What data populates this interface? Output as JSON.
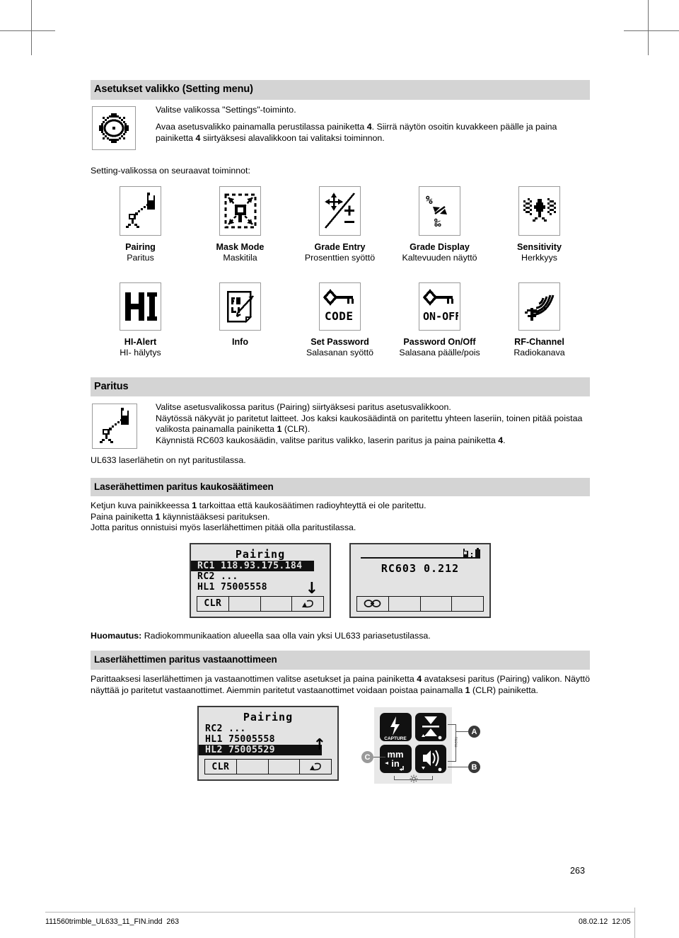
{
  "section_setting": {
    "header": "Asetukset valikko (Setting menu)",
    "icon": "gear-icon",
    "paragraphs": [
      "Valitse valikossa \"Settings\"-toiminto.",
      "Avaa asetusvalikko painamalla perustilassa painiketta 4. Siirrä näytön osoitin kuvakkeen päälle ja paina painiketta 4 siirtyäksesi alavalikkoon tai valitaksi toiminnon."
    ],
    "after_line": "Setting-valikossa on seuraavat toiminnot:"
  },
  "icon_grid": {
    "row1": [
      {
        "icon": "pairing-icon",
        "en": "Pairing",
        "fi": "Paritus"
      },
      {
        "icon": "mask-mode-icon",
        "en": "Mask Mode",
        "fi": "Maskitila"
      },
      {
        "icon": "grade-entry-icon",
        "en": "Grade Entry",
        "fi": "Prosenttien syöttö"
      },
      {
        "icon": "grade-display-icon",
        "en": "Grade Display",
        "fi": "Kaltevuuden näyttö"
      },
      {
        "icon": "sensitivity-icon",
        "en": "Sensitivity",
        "fi": "Herkkyys"
      }
    ],
    "row2": [
      {
        "icon": "hi-alert-icon",
        "en": "HI-Alert",
        "fi": "HI- hälytys"
      },
      {
        "icon": "info-icon",
        "en": "Info",
        "fi": ""
      },
      {
        "icon": "set-password-icon",
        "en": "Set Password",
        "fi": "Salasanan syöttö"
      },
      {
        "icon": "password-onoff-icon",
        "en": "Password On/Off",
        "fi": "Salasana päälle/pois"
      },
      {
        "icon": "rf-channel-icon",
        "en": "RF-Channel",
        "fi": "Radiokanava"
      }
    ]
  },
  "section_paritus": {
    "header": "Paritus",
    "icon": "pairing-icon",
    "lines": [
      "Valitse asetusvalikossa paritus (Pairing) siirtyäksesi paritus asetusvalikkoon.",
      "Näytössä näkyvät jo paritetut laitteet. Jos kaksi kaukosäädintä on paritettu yhteen laseriin, toinen pitää poistaa valikosta painamalla painiketta 1 (CLR).",
      "Käynnistä RC603 kaukosäädin, valitse paritus valikko, laserin paritus ja paina painiketta 4."
    ],
    "after_line": "UL633 laserlähetin on nyt paritustilassa."
  },
  "section_remote": {
    "header": "Laserähettimen paritus kaukosäätimeen",
    "lines": [
      "Ketjun kuva painikkeessa 1 tarkoittaa että kaukosäätimen radioyhteyttä ei ole paritettu.",
      "Paina painiketta 1 käynnistääksesi parituksen.",
      "Jotta paritus onnistuisi myös laserlähettimen pitää olla paritustilassa."
    ]
  },
  "lcd_left": {
    "title": "Pairing",
    "rows": [
      {
        "text": "RC1 118.93.175.184",
        "highlighted": true
      },
      {
        "text": "RC2 ...",
        "highlighted": false
      },
      {
        "text": "HL1 75005558",
        "highlighted": false
      }
    ],
    "scroll_arrow": "↓",
    "softkeys": [
      "CLR",
      "",
      "",
      "back-arrow-icon"
    ]
  },
  "lcd_right": {
    "value": "RC603 0.212",
    "status_icons": [
      "radio-icon",
      "battery-icon"
    ],
    "softkeys": [
      "chain-link-icon",
      "",
      "",
      ""
    ]
  },
  "note": {
    "label": "Huomautus:",
    "text": "Radiokommunikaation alueella saa olla vain yksi UL633 pariasetustilassa."
  },
  "section_receiver": {
    "header": "Laserlähettimen paritus vastaanottimeen",
    "text": "Parittaaksesi laserlähettimen ja vastaanottimen valitse asetukset ja paina painiketta 4 avataksesi paritus (Pairing) valikon. Näyttö näyttää jo paritetut vastaanottimet. Aiemmin paritetut vastaanottimet voidaan poistaa painamalla 1 (CLR) painiketta."
  },
  "lcd_bottom": {
    "title": "Pairing",
    "rows": [
      {
        "text": "RC2 ...",
        "highlighted": false
      },
      {
        "text": "HL1 75005558",
        "highlighted": false
      },
      {
        "text": "HL2 75005529",
        "highlighted": true
      }
    ],
    "scroll_arrow": "↑",
    "softkeys": [
      "CLR",
      "",
      "",
      "back-arrow-icon"
    ]
  },
  "receiver_keypad": {
    "keys": [
      {
        "icon": "capture-bolt-icon",
        "label": "CAPTURE"
      },
      {
        "icon": "hourglass-grade-icon",
        "label": ""
      },
      {
        "icon": "mm-in-icon",
        "label": "mm\nin"
      },
      {
        "icon": "speaker-icon",
        "label": ""
      }
    ],
    "callouts": [
      "A",
      "B",
      "C"
    ],
    "menu_label": "menu"
  },
  "footer": {
    "page_number": "263",
    "file_name": "111560trimble_UL633_11_FIN.indd",
    "file_page": "263",
    "date": "08.02.12",
    "time": "12:05"
  }
}
